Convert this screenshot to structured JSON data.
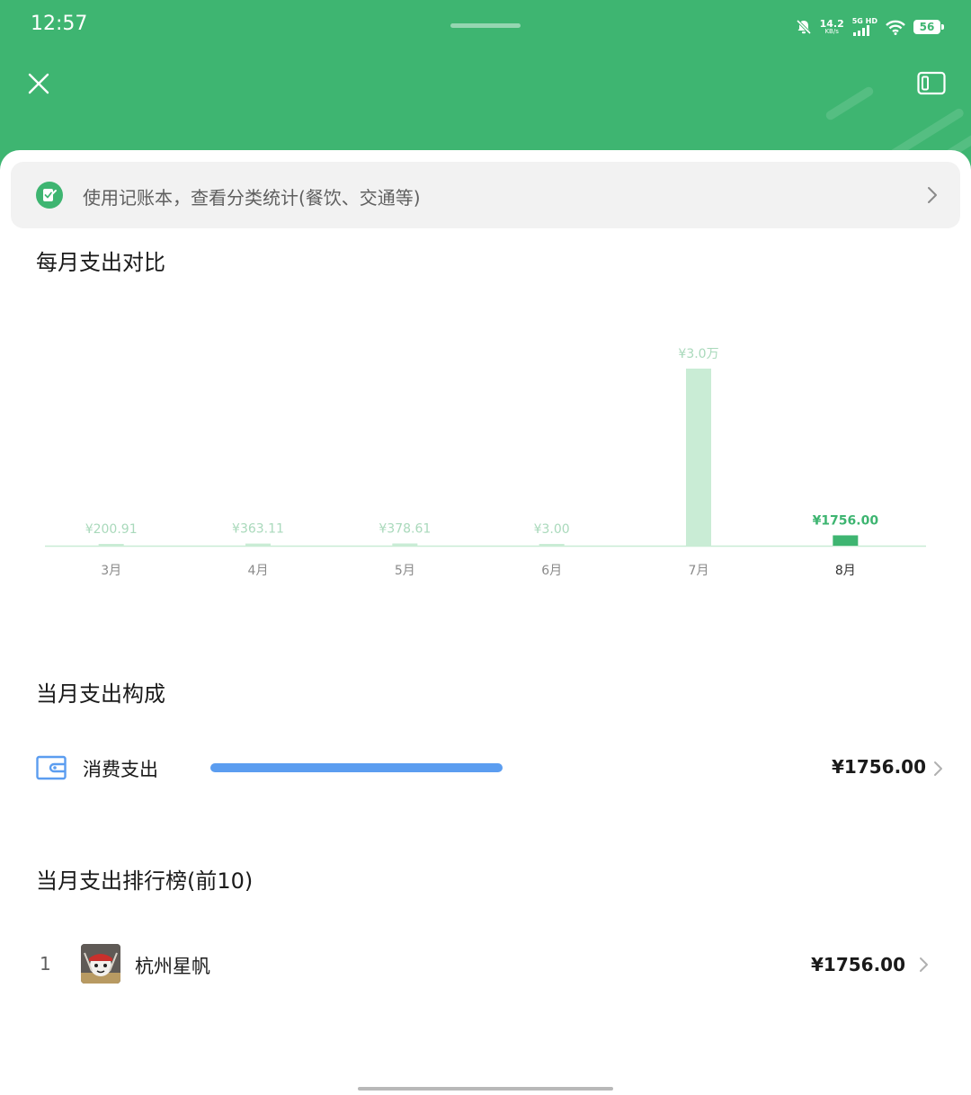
{
  "status_bar": {
    "time": "12:57",
    "net_speed": "14.2",
    "net_unit": "KB/s",
    "network_label": "5G HD",
    "battery": "56"
  },
  "banner": {
    "text": "使用记账本，查看分类统计(餐饮、交通等)"
  },
  "monthly_section": {
    "title": "每月支出对比"
  },
  "chart_data": {
    "type": "bar",
    "categories": [
      "3月",
      "4月",
      "5月",
      "6月",
      "7月",
      "8月"
    ],
    "values": [
      200.91,
      363.11,
      378.61,
      3.0,
      30000,
      1756.0
    ],
    "data_labels": [
      "¥200.91",
      "¥363.11",
      "¥378.61",
      "¥3.00",
      "¥3.0万",
      "¥1756.00"
    ],
    "highlight_index": 5,
    "colors": {
      "bar": "#c9ecd5",
      "highlight": "#3eb571",
      "label": "#a9d9bb",
      "highlight_label": "#3eb571",
      "axis": "#c9ecd5"
    }
  },
  "composition_section": {
    "title": "当月支出构成",
    "items": [
      {
        "label": "消费支出",
        "amount": "¥1756.00",
        "share": 1.0,
        "icon": "wallet-icon",
        "color": "#5b9df0"
      }
    ]
  },
  "ranking_section": {
    "title": "当月支出排行榜(前10)",
    "items": [
      {
        "rank": "1",
        "name": "杭州星帆",
        "amount": "¥1756.00"
      }
    ]
  },
  "theme": {
    "accent": "#3eb571"
  }
}
